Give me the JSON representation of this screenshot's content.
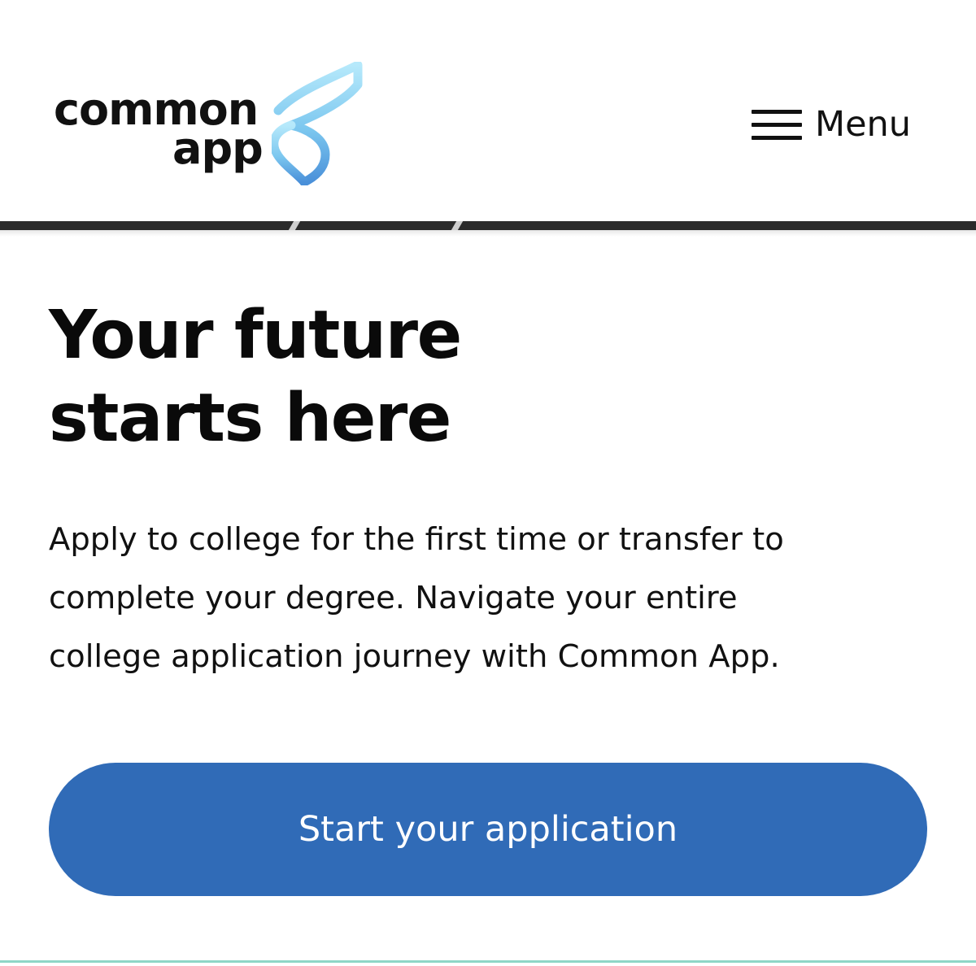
{
  "header": {
    "logo": {
      "line1": "common",
      "line2": "app"
    },
    "menu": {
      "icon": "hamburger-icon",
      "label": "Menu"
    }
  },
  "hero": {
    "headline": "Your future\nstarts here",
    "description": "Apply to college for the first time or transfer to\ncomplete your degree.   Navigate your entire\ncollege application journey with Common App.",
    "cta_label": "Start your application"
  },
  "colors": {
    "cta_background": "#306bb7",
    "cta_text": "#ffffff",
    "logo_mark_light": "#a9e2f7",
    "logo_mark_dark": "#4a90d9",
    "bottom_accent": "#8ed6c7"
  }
}
